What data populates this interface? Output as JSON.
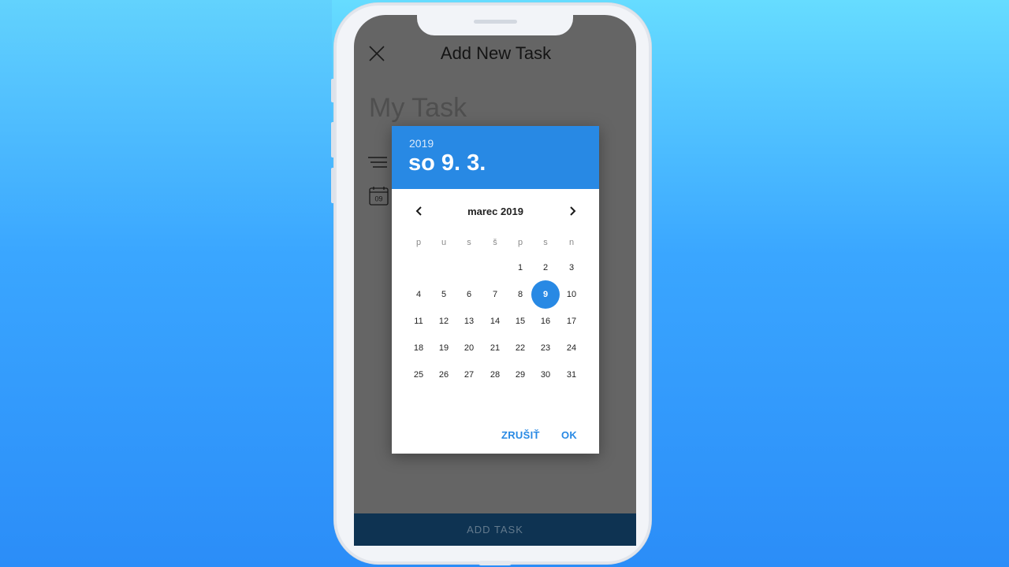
{
  "app": {
    "title": "Add New Task",
    "task_name": "My Task",
    "add_task_label": "ADD TASK",
    "calendar_icon_day": "09",
    "accent_color": "#2889e4",
    "icons": [
      "close-icon",
      "menu-lines-icon",
      "calendar-icon"
    ]
  },
  "date_dialog": {
    "year": "2019",
    "selected_date_label": "so 9. 3.",
    "month_label": "marec 2019",
    "weekdays": [
      "p",
      "u",
      "s",
      "š",
      "p",
      "s",
      "n"
    ],
    "first_weekday_index": 4,
    "days_in_month": 31,
    "selected_day": 9,
    "cancel_label": "ZRUŠIŤ",
    "ok_label": "OK",
    "icons": [
      "chevron-left-icon",
      "chevron-right-icon"
    ]
  }
}
